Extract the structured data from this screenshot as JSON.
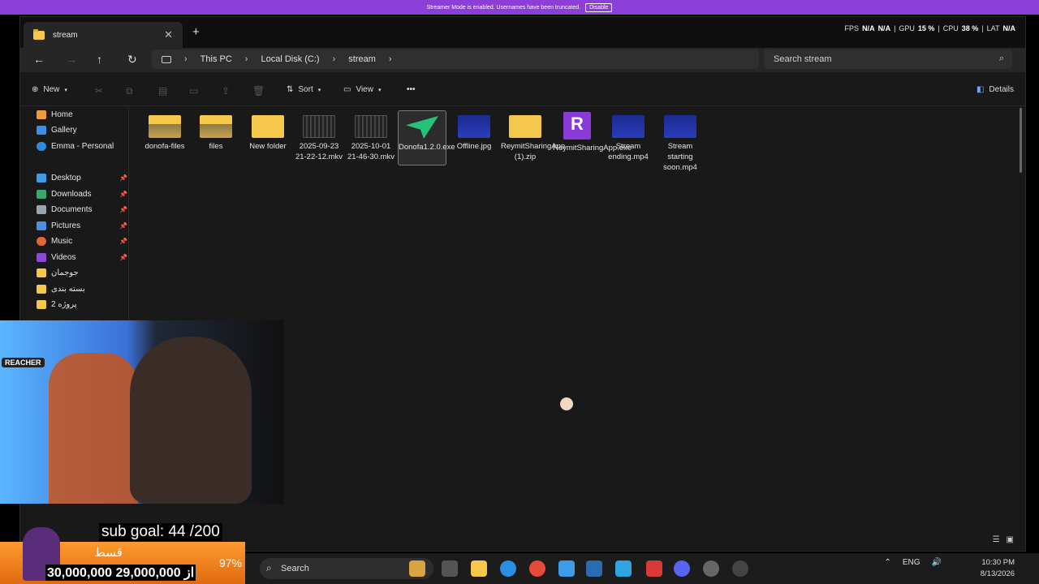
{
  "banner": {
    "text": "Streamer Mode is enabled. Usernames have been truncated.",
    "button": "Disable"
  },
  "tab": {
    "title": "stream",
    "close": "✕",
    "new": "+"
  },
  "overlay_stats": {
    "fps_label": "FPS",
    "fps1": "N/A",
    "fps2": "N/A",
    "gpu_label": "GPU",
    "gpu": "15 %",
    "cpu_label": "CPU",
    "cpu": "38 %",
    "lat_label": "LAT",
    "lat": "N/A"
  },
  "nav": {
    "back": "←",
    "forward": "→",
    "up": "↑",
    "refresh": "↻"
  },
  "breadcrumb": [
    "This PC",
    "Local Disk (C:)",
    "stream"
  ],
  "search": {
    "placeholder": "Search stream"
  },
  "toolbar": {
    "new": "New",
    "sort": "Sort",
    "view": "View",
    "more": "•••",
    "details": "Details"
  },
  "sidebar": {
    "top": [
      "Home",
      "Gallery",
      "Emma - Personal"
    ],
    "pinned": [
      "Desktop",
      "Downloads",
      "Documents",
      "Pictures",
      "Music",
      "Videos"
    ],
    "folders": [
      "جوجمان",
      "بسته بندی",
      "پروژه 2"
    ]
  },
  "files": [
    {
      "name": "donofa-files",
      "type": "folder-img"
    },
    {
      "name": "files",
      "type": "folder-img"
    },
    {
      "name": "New folder",
      "type": "folder"
    },
    {
      "name": "2025-09-23 21-22-12.mkv",
      "type": "video"
    },
    {
      "name": "2025-10-01 21-46-30.mkv",
      "type": "video"
    },
    {
      "name": "Donofa1.2.0.exe",
      "type": "exe-green",
      "selected": true
    },
    {
      "name": "Offline.jpg",
      "type": "blue"
    },
    {
      "name": "ReymitSharingApp (1).zip",
      "type": "folder"
    },
    {
      "name": "ReymitSharingApp.exe",
      "type": "purple"
    },
    {
      "name": "Stream ending.mp4",
      "type": "blue"
    },
    {
      "name": "Stream starting soon.mp4",
      "type": "blue"
    }
  ],
  "webcam": {
    "tag": "REACHER"
  },
  "subgoal": {
    "text": "sub goal: 44 /200",
    "farsi": "قسط",
    "percent": "97%",
    "money": "30,000,000 از 29,000,000"
  },
  "taskbar": {
    "search": "Search",
    "lang": "ENG",
    "time": "10:30 PM",
    "date": "8/13/2026"
  }
}
